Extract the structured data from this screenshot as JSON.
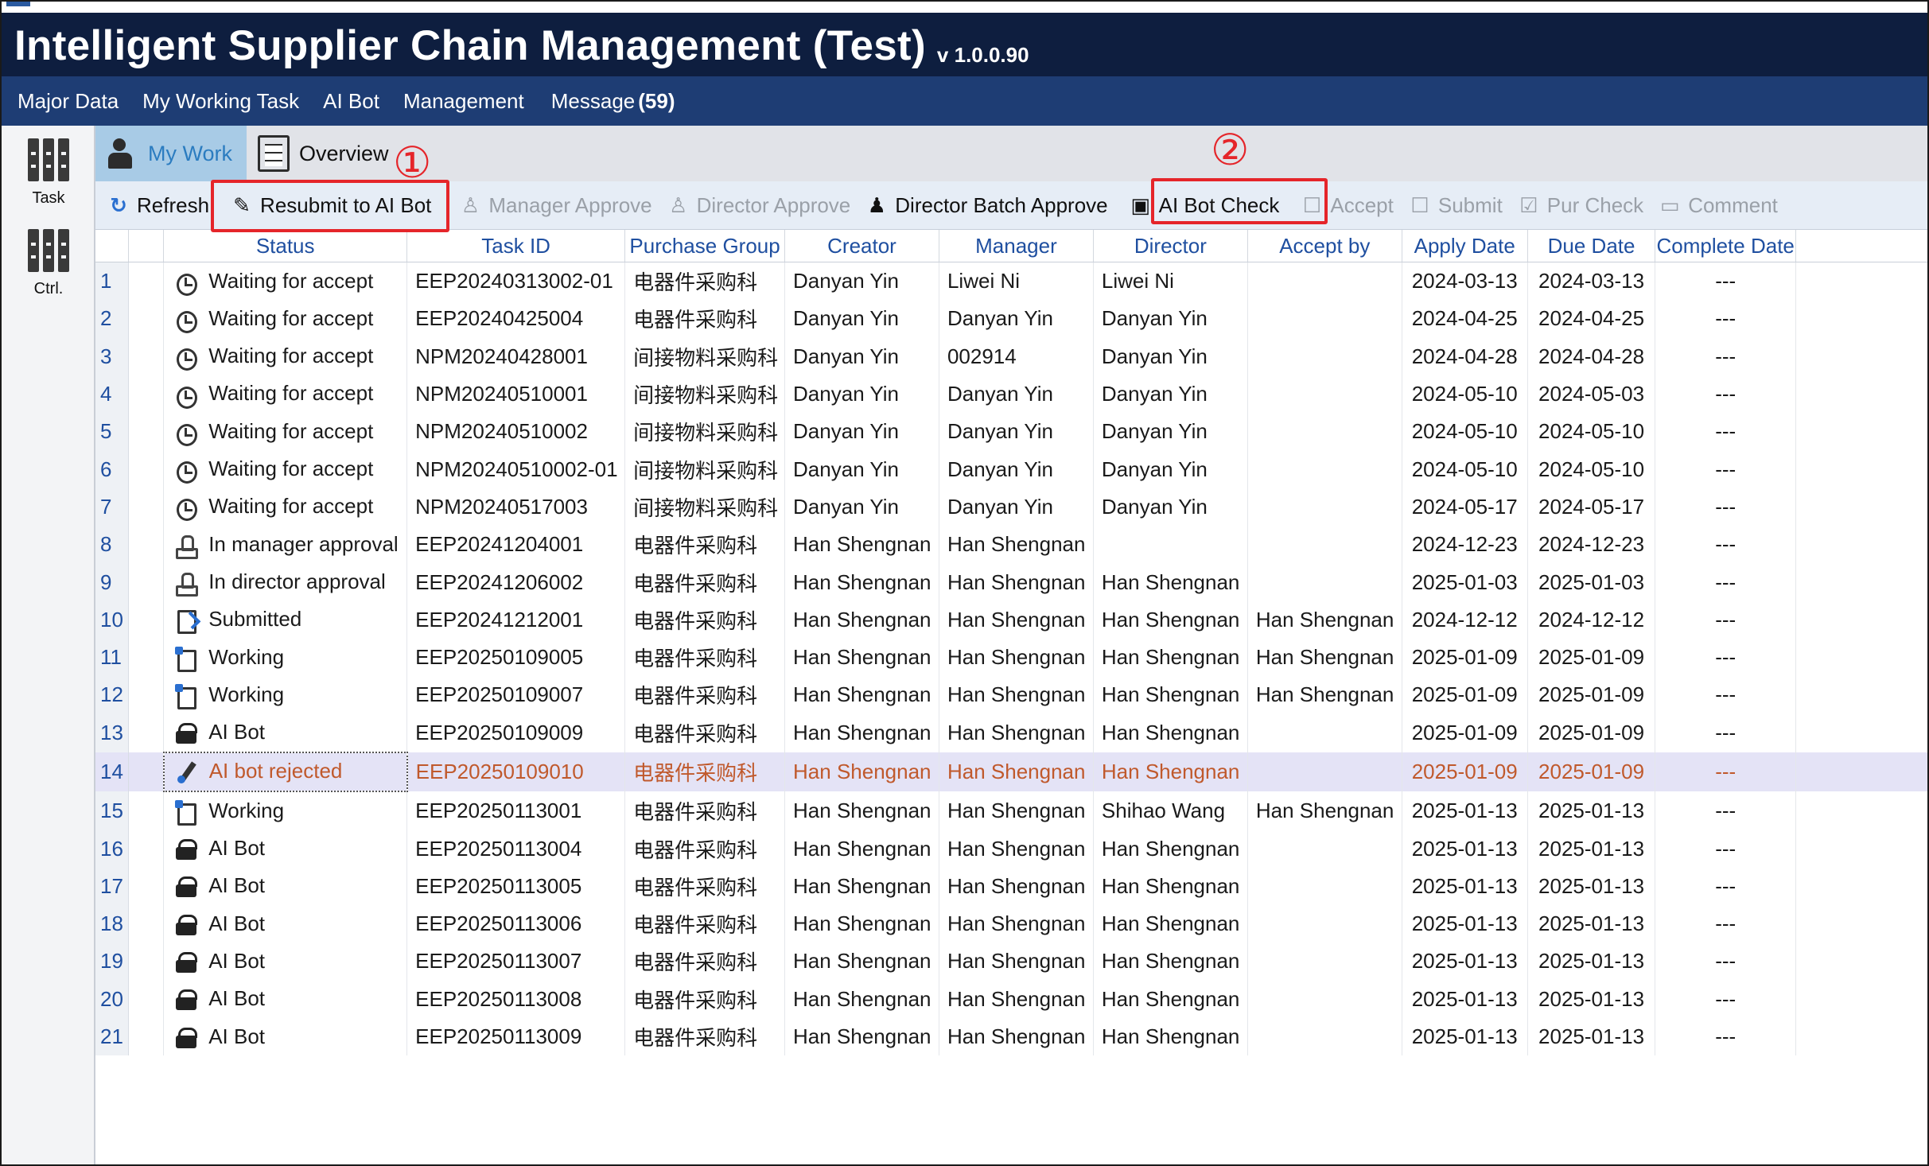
{
  "app": {
    "title": "Intelligent Supplier Chain Management (Test)",
    "version": "v 1.0.0.90"
  },
  "menu": [
    {
      "label": "Major Data"
    },
    {
      "label": "My Working Task"
    },
    {
      "label": "AI Bot"
    },
    {
      "label": "Management"
    }
  ],
  "message": {
    "label": "Message",
    "count": "(59)"
  },
  "side": {
    "task": "Task",
    "ctrl": "Ctrl."
  },
  "tabs": {
    "my_work": "My Work",
    "overview": "Overview"
  },
  "toolbar": {
    "refresh": "Refresh",
    "resubmit": "Resubmit to AI Bot",
    "manager_approve": "Manager Approve",
    "director_approve": "Director Approve",
    "director_batch": "Director Batch Approve",
    "ai_bot_check": "AI Bot Check",
    "accept": "Accept",
    "submit": "Submit",
    "pur_check": "Pur Check",
    "comment": "Comment"
  },
  "annotations": {
    "one": "①",
    "two": "②"
  },
  "columns": [
    "Status",
    "Task ID",
    "Purchase Group",
    "Creator",
    "Manager",
    "Director",
    "Accept by",
    "Apply Date",
    "Due Date",
    "Complete Date"
  ],
  "rows": [
    {
      "n": "1",
      "icon": "clock",
      "status": "Waiting for accept",
      "task_id": "EEP20240313002-01",
      "group": "电器件采购科",
      "creator": "Danyan Yin",
      "manager": "Liwei Ni",
      "director": "Liwei Ni",
      "accept_by": "",
      "apply": "2024-03-13",
      "due": "2024-03-13",
      "complete": "---"
    },
    {
      "n": "2",
      "icon": "clock",
      "status": "Waiting for accept",
      "task_id": "EEP20240425004",
      "group": "电器件采购科",
      "creator": "Danyan Yin",
      "manager": "Danyan Yin",
      "director": "Danyan Yin",
      "accept_by": "",
      "apply": "2024-04-25",
      "due": "2024-04-25",
      "complete": "---"
    },
    {
      "n": "3",
      "icon": "clock",
      "status": "Waiting for accept",
      "task_id": "NPM20240428001",
      "group": "间接物料采购科",
      "creator": "Danyan Yin",
      "manager": "002914",
      "director": "Danyan Yin",
      "accept_by": "",
      "apply": "2024-04-28",
      "due": "2024-04-28",
      "complete": "---"
    },
    {
      "n": "4",
      "icon": "clock",
      "status": "Waiting for accept",
      "task_id": "NPM20240510001",
      "group": "间接物料采购科",
      "creator": "Danyan Yin",
      "manager": "Danyan Yin",
      "director": "Danyan Yin",
      "accept_by": "",
      "apply": "2024-05-10",
      "due": "2024-05-03",
      "complete": "---"
    },
    {
      "n": "5",
      "icon": "clock",
      "status": "Waiting for accept",
      "task_id": "NPM20240510002",
      "group": "间接物料采购科",
      "creator": "Danyan Yin",
      "manager": "Danyan Yin",
      "director": "Danyan Yin",
      "accept_by": "",
      "apply": "2024-05-10",
      "due": "2024-05-10",
      "complete": "---"
    },
    {
      "n": "6",
      "icon": "clock",
      "status": "Waiting for accept",
      "task_id": "NPM20240510002-01",
      "group": "间接物料采购科",
      "creator": "Danyan Yin",
      "manager": "Danyan Yin",
      "director": "Danyan Yin",
      "accept_by": "",
      "apply": "2024-05-10",
      "due": "2024-05-10",
      "complete": "---"
    },
    {
      "n": "7",
      "icon": "clock",
      "status": "Waiting for accept",
      "task_id": "NPM20240517003",
      "group": "间接物料采购科",
      "creator": "Danyan Yin",
      "manager": "Danyan Yin",
      "director": "Danyan Yin",
      "accept_by": "",
      "apply": "2024-05-17",
      "due": "2024-05-17",
      "complete": "---"
    },
    {
      "n": "8",
      "icon": "stamp",
      "status": "In manager approval",
      "task_id": "EEP20241204001",
      "group": "电器件采购科",
      "creator": "Han Shengnan",
      "manager": "Han Shengnan",
      "director": "",
      "accept_by": "",
      "apply": "2024-12-23",
      "due": "2024-12-23",
      "complete": "---"
    },
    {
      "n": "9",
      "icon": "stamp",
      "status": "In director approval",
      "task_id": "EEP20241206002",
      "group": "电器件采购科",
      "creator": "Han Shengnan",
      "manager": "Han Shengnan",
      "director": "Han Shengnan",
      "accept_by": "",
      "apply": "2025-01-03",
      "due": "2025-01-03",
      "complete": "---"
    },
    {
      "n": "10",
      "icon": "doc",
      "status": "Submitted",
      "task_id": "EEP20241212001",
      "group": "电器件采购科",
      "creator": "Han Shengnan",
      "manager": "Han Shengnan",
      "director": "Han Shengnan",
      "accept_by": "Han Shengnan",
      "apply": "2024-12-12",
      "due": "2024-12-12",
      "complete": "---"
    },
    {
      "n": "11",
      "icon": "work",
      "status": "Working",
      "task_id": "EEP20250109005",
      "group": "电器件采购科",
      "creator": "Han Shengnan",
      "manager": "Han Shengnan",
      "director": "Han Shengnan",
      "accept_by": "Han Shengnan",
      "apply": "2025-01-09",
      "due": "2025-01-09",
      "complete": "---"
    },
    {
      "n": "12",
      "icon": "work",
      "status": "Working",
      "task_id": "EEP20250109007",
      "group": "电器件采购科",
      "creator": "Han Shengnan",
      "manager": "Han Shengnan",
      "director": "Han Shengnan",
      "accept_by": "Han Shengnan",
      "apply": "2025-01-09",
      "due": "2025-01-09",
      "complete": "---"
    },
    {
      "n": "13",
      "icon": "bot",
      "status": "AI Bot",
      "task_id": "EEP20250109009",
      "group": "电器件采购科",
      "creator": "Han Shengnan",
      "manager": "Han Shengnan",
      "director": "Han Shengnan",
      "accept_by": "",
      "apply": "2025-01-09",
      "due": "2025-01-09",
      "complete": "---"
    },
    {
      "n": "14",
      "icon": "pen",
      "status": "AI bot rejected",
      "task_id": "EEP20250109010",
      "group": "电器件采购科",
      "creator": "Han Shengnan",
      "manager": "Han Shengnan",
      "director": "Han Shengnan",
      "accept_by": "",
      "apply": "2025-01-09",
      "due": "2025-01-09",
      "complete": "---"
    },
    {
      "n": "15",
      "icon": "work",
      "status": "Working",
      "task_id": "EEP20250113001",
      "group": "电器件采购科",
      "creator": "Han Shengnan",
      "manager": "Han Shengnan",
      "director": "Shihao Wang",
      "accept_by": "Han Shengnan",
      "apply": "2025-01-13",
      "due": "2025-01-13",
      "complete": "---"
    },
    {
      "n": "16",
      "icon": "bot",
      "status": "AI Bot",
      "task_id": "EEP20250113004",
      "group": "电器件采购科",
      "creator": "Han Shengnan",
      "manager": "Han Shengnan",
      "director": "Han Shengnan",
      "accept_by": "",
      "apply": "2025-01-13",
      "due": "2025-01-13",
      "complete": "---"
    },
    {
      "n": "17",
      "icon": "bot",
      "status": "AI Bot",
      "task_id": "EEP20250113005",
      "group": "电器件采购科",
      "creator": "Han Shengnan",
      "manager": "Han Shengnan",
      "director": "Han Shengnan",
      "accept_by": "",
      "apply": "2025-01-13",
      "due": "2025-01-13",
      "complete": "---"
    },
    {
      "n": "18",
      "icon": "bot",
      "status": "AI Bot",
      "task_id": "EEP20250113006",
      "group": "电器件采购科",
      "creator": "Han Shengnan",
      "manager": "Han Shengnan",
      "director": "Han Shengnan",
      "accept_by": "",
      "apply": "2025-01-13",
      "due": "2025-01-13",
      "complete": "---"
    },
    {
      "n": "19",
      "icon": "bot",
      "status": "AI Bot",
      "task_id": "EEP20250113007",
      "group": "电器件采购科",
      "creator": "Han Shengnan",
      "manager": "Han Shengnan",
      "director": "Han Shengnan",
      "accept_by": "",
      "apply": "2025-01-13",
      "due": "2025-01-13",
      "complete": "---"
    },
    {
      "n": "20",
      "icon": "bot",
      "status": "AI Bot",
      "task_id": "EEP20250113008",
      "group": "电器件采购科",
      "creator": "Han Shengnan",
      "manager": "Han Shengnan",
      "director": "Han Shengnan",
      "accept_by": "",
      "apply": "2025-01-13",
      "due": "2025-01-13",
      "complete": "---"
    },
    {
      "n": "21",
      "icon": "bot",
      "status": "AI Bot",
      "task_id": "EEP20250113009",
      "group": "电器件采购科",
      "creator": "Han Shengnan",
      "manager": "Han Shengnan",
      "director": "Han Shengnan",
      "accept_by": "",
      "apply": "2025-01-13",
      "due": "2025-01-13",
      "complete": "---"
    }
  ],
  "selected_row": "14",
  "colors": {
    "titlebar": "#0e1e3f",
    "menubar": "#1e3d74",
    "highlight": "#e5252a",
    "header_text": "#1f4fa0",
    "selected_text": "#c0592c"
  }
}
